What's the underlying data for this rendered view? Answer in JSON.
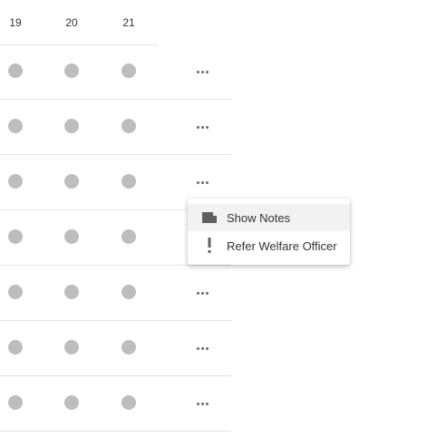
{
  "grid": {
    "day_headers": [
      "19",
      "20",
      "21"
    ],
    "row_count": 7,
    "more_icon": "ellipsis-horizontal-icon",
    "status_dot_color": "#bdbdbd"
  },
  "context_menu": {
    "items": [
      {
        "label": "Show Notes",
        "icon": "note-icon"
      },
      {
        "label": "Refer Welfare Officer",
        "icon": "exclamation-icon"
      }
    ],
    "highlight_color": "#f2f2f2"
  }
}
